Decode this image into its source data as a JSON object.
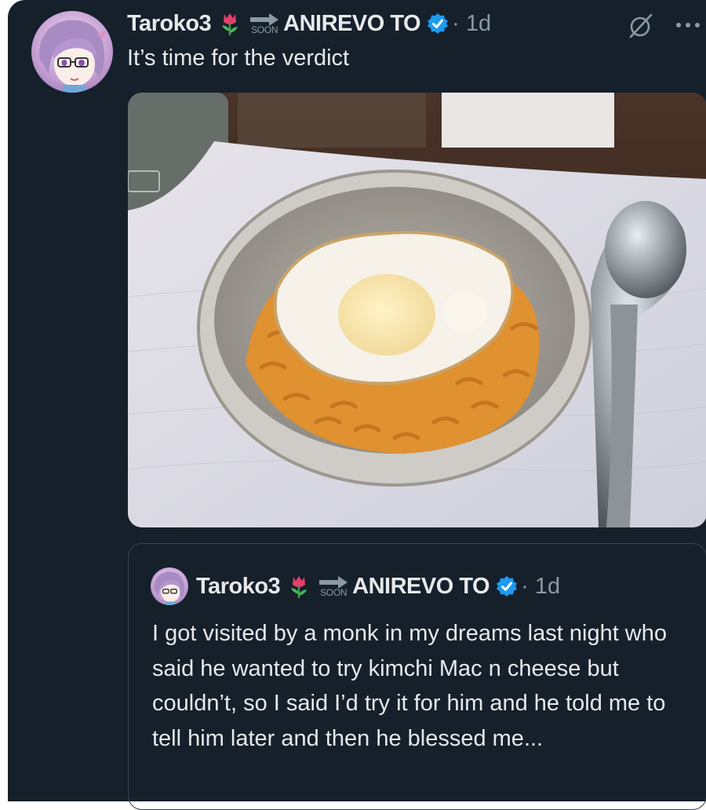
{
  "tweet": {
    "author_name": "Taroko3",
    "badge_text": "SOON",
    "affiliation": "ANIREVO TO",
    "time": "· 1d",
    "text": "It’s time for the verdict"
  },
  "quoted_tweet": {
    "author_name": "Taroko3",
    "badge_text": "SOON",
    "affiliation": "ANIREVO TO",
    "time": "· 1d",
    "text": "I got visited by a monk in my dreams last night who said he wanted to try kimchi Mac n cheese but couldn’t, so I said I’d try it for him and he told me to tell him later and then he blessed me..."
  },
  "icons": {
    "avatar": "anime-avatar",
    "emoji": "tulip-icon",
    "arrow": "arrow-right-icon",
    "verified": "verified-badge-icon",
    "grok": "grok-icon",
    "more": "more-icon"
  },
  "colors": {
    "background": "#15202b",
    "text": "#e7e9ea",
    "muted": "#8b98a5",
    "verified": "#1d9bf0",
    "border": "#38444d"
  }
}
